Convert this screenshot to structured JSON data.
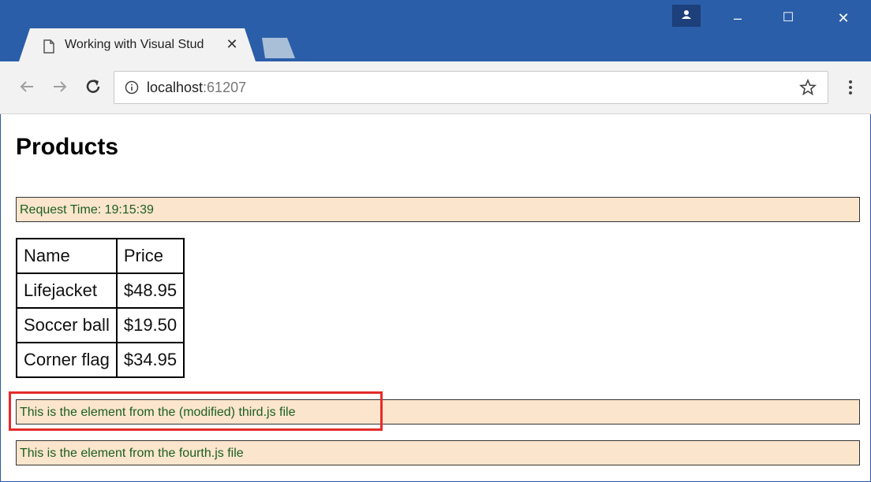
{
  "browser": {
    "tab_title": "Working with Visual Stud",
    "tab_close": "✕",
    "url_host": "localhost",
    "url_port": ":61207",
    "window_controls": {
      "minimize": "–",
      "maximize": "☐",
      "close": "✕"
    }
  },
  "page": {
    "title": "Products",
    "request_time": "Request Time: 19:15:39",
    "table": {
      "headers": [
        "Name",
        "Price"
      ],
      "rows": [
        [
          "Lifejacket",
          "$48.95"
        ],
        [
          "Soccer ball",
          "$19.50"
        ],
        [
          "Corner flag",
          "$34.95"
        ]
      ]
    },
    "third_message": "This is the element from the (modified) third.js file",
    "fourth_message": "This is the element from the fourth.js file"
  },
  "colors": {
    "titlebar": "#2b5ea8",
    "box_fill": "#fbe5cc",
    "box_text": "#1b5e20",
    "highlight": "#e52b2b"
  },
  "icons": [
    "page-icon",
    "profile-icon",
    "back-icon",
    "forward-icon",
    "reload-icon",
    "info-icon",
    "star-icon",
    "menu-icon"
  ]
}
